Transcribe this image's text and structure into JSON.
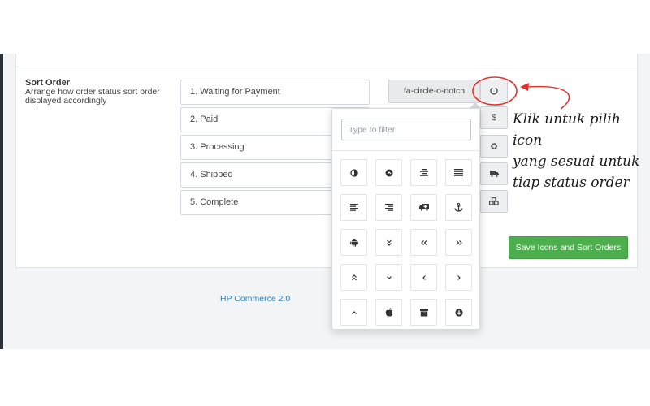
{
  "sort_order": {
    "title": "Sort Order",
    "help": "Arrange how order status sort order displayed accordingly",
    "statuses": [
      "1. Waiting for Payment",
      "2. Paid",
      "3. Processing",
      "4. Shipped",
      "5. Complete"
    ]
  },
  "icon_picker": {
    "selected_icon": "fa-circle-o-notch",
    "filter_placeholder": "Type to filter",
    "addons": [
      "circle-o-notch-icon",
      "dollar-icon",
      "recycle-icon",
      "truck-icon",
      "cubes-icon"
    ],
    "grid_icons": [
      "adjust-icon",
      "chevron-circle-up-icon",
      "align-center-icon",
      "align-justify-icon",
      "align-left-icon",
      "align-right-icon",
      "ambulance-icon",
      "anchor-icon",
      "android-icon",
      "angle-double-down-icon",
      "angle-double-left-icon",
      "angle-double-right-icon",
      "angle-double-up-icon",
      "angle-down-icon",
      "angle-left-icon",
      "angle-right-icon",
      "angle-up-icon",
      "apple-icon",
      "archive-icon",
      "arrow-circle-down-icon"
    ]
  },
  "save_button_label": "Save Icons and Sort Orders",
  "footer": {
    "link": "HP Commerce 2.0"
  },
  "annotation": {
    "lines": [
      "Klik untuk pilih icon",
      "yang sesuai untuk",
      "tiap status order"
    ],
    "color": "#e0322b"
  }
}
